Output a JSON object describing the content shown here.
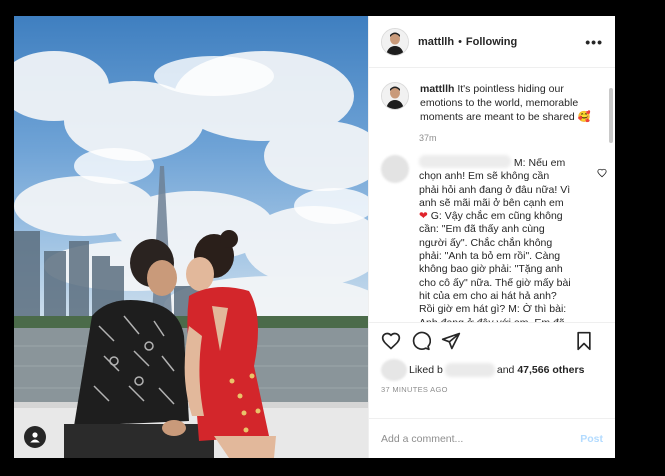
{
  "header": {
    "username": "mattllh",
    "separator": "•",
    "follow_status": "Following",
    "more_label": "•••"
  },
  "caption": {
    "username": "mattllh",
    "text": "It's pointless hiding our emotions to the world, memorable moments are meant to be shared 🥰",
    "time": "37m"
  },
  "comment": {
    "lines_before_heart": "M: Nếu em chọn anh! Em sẽ không cần phải hỏi anh đang ở đâu nữa! Vì anh sẽ mãi mãi ở bên cạnh em ",
    "heart": "❤",
    "lines_after_heart": " G: Vậy chắc em cũng không cần: \"Em đã thấy anh cùng người ấy\". Chắc chắn không phải: \"Anh ta bỏ em rồi\". Càng không bao giờ phải: \"Tặng anh cho cô ấy\" nữa. Thế giờ mấy bài hit của em cho ai hát hả anh? Rồi giờ em hát gì? M: Ờ thì bài: Anh đang ở đây với em, Em đã thấy anh vẫn ngồi đây, Tặng anh cho em đấy..."
  },
  "likes": {
    "prefix": "Liked b",
    "and": "and",
    "count": "47,566 others"
  },
  "timestamp": "37 MINUTES AGO",
  "add_comment": {
    "placeholder": "Add a comment...",
    "post_label": "Post"
  },
  "colors": {
    "heart": "#e0242c",
    "post_disabled": "#b3dbff",
    "secondary_text": "#8e8e8e"
  }
}
